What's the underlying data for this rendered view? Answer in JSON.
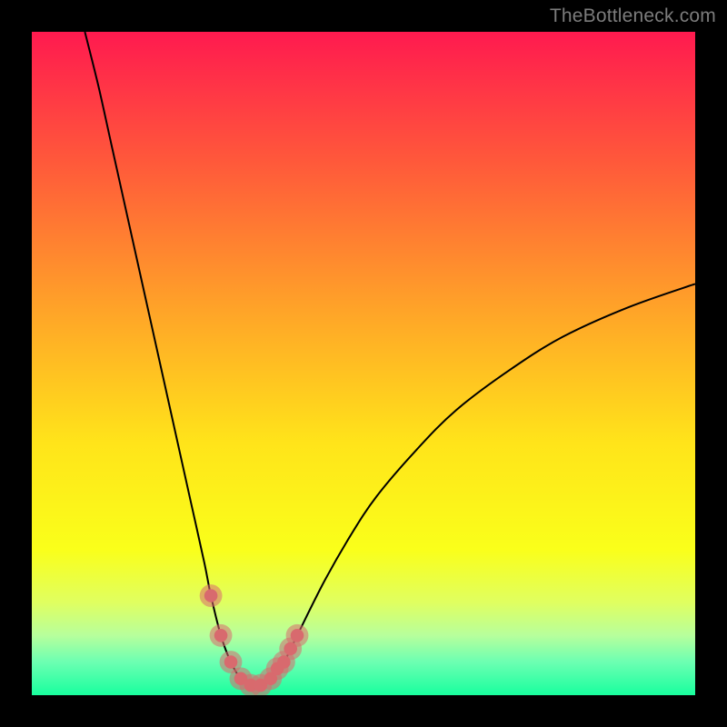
{
  "watermark": "TheBottleneck.com",
  "chart_data": {
    "type": "line",
    "title": "",
    "xlabel": "",
    "ylabel": "",
    "xlim": [
      0,
      100
    ],
    "ylim": [
      0,
      100
    ],
    "grid": false,
    "legend": false,
    "background_gradient": {
      "stops": [
        {
          "offset": 0.0,
          "color": "#ff1a4f"
        },
        {
          "offset": 0.2,
          "color": "#ff5a3a"
        },
        {
          "offset": 0.42,
          "color": "#ffa428"
        },
        {
          "offset": 0.62,
          "color": "#ffe41a"
        },
        {
          "offset": 0.78,
          "color": "#faff1a"
        },
        {
          "offset": 0.86,
          "color": "#e0ff60"
        },
        {
          "offset": 0.91,
          "color": "#b7ff9c"
        },
        {
          "offset": 0.95,
          "color": "#6cffb2"
        },
        {
          "offset": 1.0,
          "color": "#18ff9e"
        }
      ]
    },
    "series": [
      {
        "name": "bottleneck-curve",
        "color": "#000000",
        "x": [
          8,
          10,
          12,
          14,
          16,
          18,
          20,
          22,
          24,
          26,
          27,
          28.5,
          30,
          31.5,
          33,
          34.5,
          36,
          38,
          40,
          44,
          48,
          52,
          58,
          64,
          72,
          80,
          90,
          100
        ],
        "y": [
          100,
          92,
          83,
          74,
          65,
          56,
          47,
          38,
          29,
          20,
          15,
          9,
          5,
          2.5,
          1.5,
          1.5,
          2.5,
          5,
          9,
          17,
          24,
          30,
          37,
          43,
          49,
          54,
          58.5,
          62
        ]
      }
    ],
    "markers": {
      "name": "highlight-dots",
      "color": "#d86a6e",
      "radius_outer": 1.7,
      "radius_inner": 1.0,
      "points": [
        {
          "x": 27.0,
          "y": 15.0
        },
        {
          "x": 28.5,
          "y": 9.0
        },
        {
          "x": 30.0,
          "y": 5.0
        },
        {
          "x": 31.5,
          "y": 2.5
        },
        {
          "x": 33.0,
          "y": 1.5
        },
        {
          "x": 34.5,
          "y": 1.5
        },
        {
          "x": 36.0,
          "y": 2.5
        },
        {
          "x": 37.0,
          "y": 4.0
        },
        {
          "x": 38.0,
          "y": 5.0
        },
        {
          "x": 39.0,
          "y": 7.0
        },
        {
          "x": 40.0,
          "y": 9.0
        }
      ]
    }
  }
}
